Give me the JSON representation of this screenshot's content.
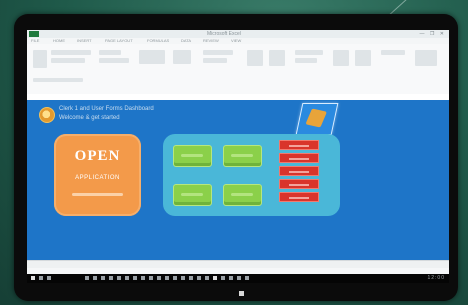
{
  "window": {
    "title": "Microsoft Excel",
    "controls": "—  ❐  ✕"
  },
  "ribbon": {
    "tabs": [
      "FILE",
      "HOME",
      "INSERT",
      "PAGE LAYOUT",
      "FORMULAS",
      "DATA",
      "REVIEW",
      "VIEW"
    ]
  },
  "dashboard": {
    "subtitle_line1": "Clerk 1 and User Forms Dashboard",
    "subtitle_line2": "Welcome & get started",
    "main_card": {
      "title": "OPEN",
      "subtitle": "APPLICATION"
    },
    "green_buttons": [
      "",
      "",
      "",
      ""
    ],
    "red_buttons": [
      "",
      "",
      "",
      "",
      ""
    ]
  },
  "taskbar": {
    "clock": "12:00"
  },
  "colors": {
    "sheet_bg": "#1e75c8",
    "card_orange": "#f39a4a",
    "panel_cyan": "#4ab7d8",
    "button_green": "#8bd04a",
    "button_red": "#d9342b"
  }
}
